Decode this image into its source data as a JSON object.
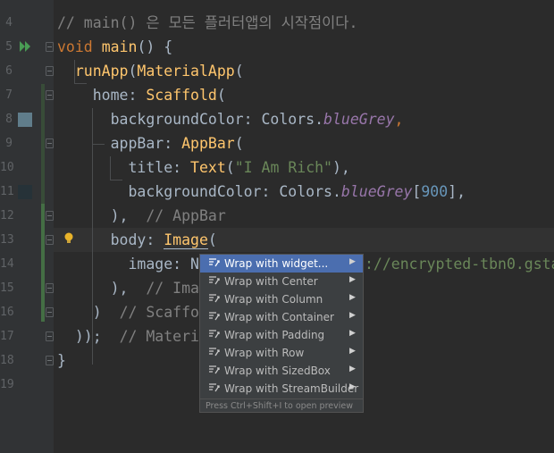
{
  "gutter": {
    "line_numbers": [
      "4",
      "5",
      "6",
      "7",
      "8",
      "9",
      "10",
      "11",
      "12",
      "13",
      "14",
      "15",
      "16",
      "17",
      "18",
      "19"
    ],
    "color_swatch_1": "#607d8b",
    "color_swatch_2": "#263238",
    "run_icon": "run-arrow-icon",
    "intention_icon": "bulb-icon"
  },
  "editor": {
    "line4": "// main() 은 모든 플러터앱의 시작점이다.",
    "line5": {
      "kw": "void",
      "fn": "main",
      "rest": "() {"
    },
    "line6": {
      "fn": "runApp",
      "p1": "(",
      "cls": "MaterialApp",
      "p2": "("
    },
    "line7": {
      "key": "home: ",
      "cls": "Scaffold",
      "p": "("
    },
    "line8": {
      "key": "backgroundColor: Colors.",
      "prop": "blueGrey",
      "p": ","
    },
    "line9": {
      "key": "appBar: ",
      "cls": "AppBar",
      "p": "("
    },
    "line10": {
      "key": "title: ",
      "cls": "Text",
      "p1": "(",
      "str": "\"I Am Rich\"",
      "p2": "),"
    },
    "line11": {
      "key": "backgroundColor: Colors.",
      "prop": "blueGrey",
      "b1": "[",
      "num": "900",
      "b2": "],"
    },
    "line12": {
      "p": "),",
      "cm": "// AppBar"
    },
    "line13": {
      "key": "body: ",
      "cls": "Image",
      "p": "("
    },
    "line14": {
      "key": "image: N",
      "tail": "://encrypted-tbn0.gsta"
    },
    "line15": {
      "p": "),",
      "cm": "// Ima"
    },
    "line16": {
      "p": ")",
      "cm": "// Scaffo"
    },
    "line17": {
      "p": "));",
      "cm": "// Materi"
    },
    "line18": {
      "p": "}"
    }
  },
  "popup": {
    "items": [
      {
        "label": "Wrap with widget..."
      },
      {
        "label": "Wrap with Center"
      },
      {
        "label": "Wrap with Column"
      },
      {
        "label": "Wrap with Container"
      },
      {
        "label": "Wrap with Padding"
      },
      {
        "label": "Wrap with Row"
      },
      {
        "label": "Wrap with SizedBox"
      },
      {
        "label": "Wrap with StreamBuilder"
      }
    ],
    "arrow": "▶",
    "footer": "Press Ctrl+Shift+I to open preview",
    "selected_color": "#4b6eaf"
  }
}
